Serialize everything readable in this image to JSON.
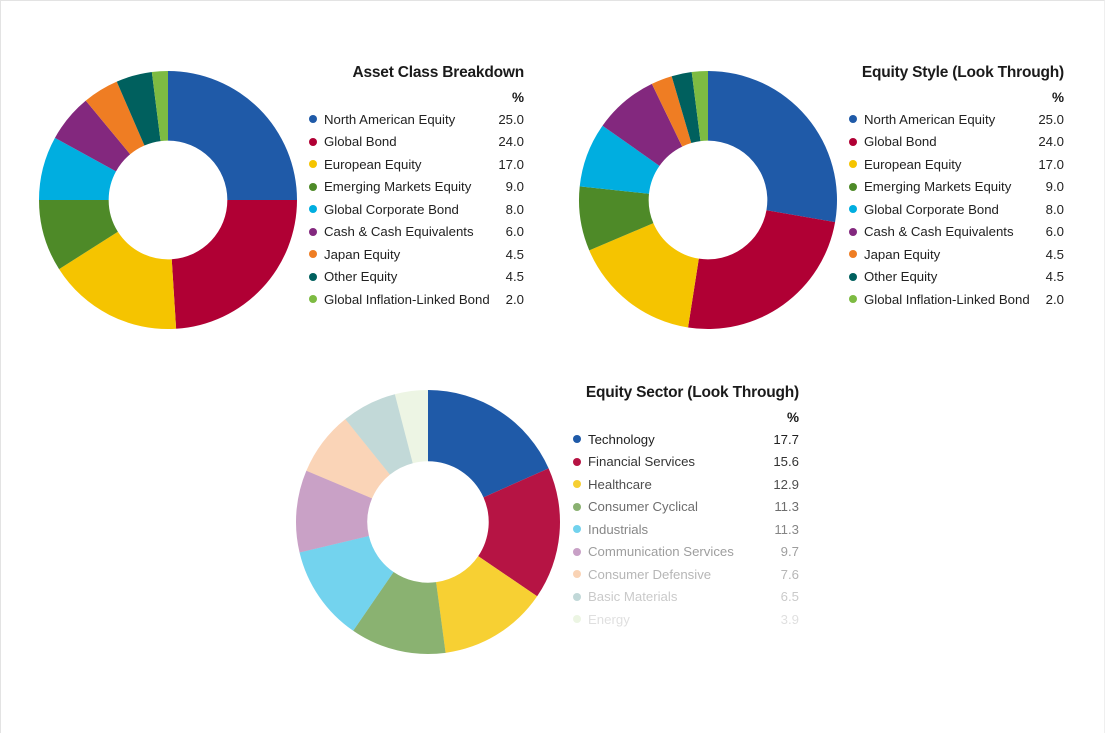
{
  "page": {
    "background": "#ffffff",
    "border_color": "#e3e3e3"
  },
  "palette": {
    "blue": "#1F5AA8",
    "crimson": "#B00034",
    "yellow": "#F5C400",
    "green": "#4E8A28",
    "cyan": "#00AEE0",
    "purple": "#83287E",
    "orange": "#EF7D23",
    "teal": "#00605E",
    "lightgreen": "#7DBB42"
  },
  "charts": [
    {
      "id": "asset-class-breakdown",
      "title": "Asset Class Breakdown",
      "value_header": "%",
      "chart_data": {
        "type": "pie",
        "title": "Asset Class Breakdown",
        "xlabel": "",
        "ylabel": "%",
        "categories": [
          "North American Equity",
          "Global Bond",
          "European Equity",
          "Emerging Markets Equity",
          "Global Corporate Bond",
          "Cash & Cash Equivalents",
          "Japan Equity",
          "Other Equity",
          "Global Inflation-Linked Bond"
        ],
        "values": [
          25.0,
          24.0,
          17.0,
          9.0,
          8.0,
          6.0,
          4.5,
          4.5,
          2.0
        ],
        "value_labels": [
          "25.0",
          "24.0",
          "17.0",
          "9.0",
          "8.0",
          "6.0",
          "4.5",
          "4.5",
          "2.0"
        ],
        "colors": [
          "#1F5AA8",
          "#B00034",
          "#F5C400",
          "#4E8A28",
          "#00AEE0",
          "#83287E",
          "#EF7D23",
          "#00605E",
          "#7DBB42"
        ],
        "legend_position": "right",
        "donut_hole_ratio": 0.46,
        "start_angle_deg": -90,
        "draw_order": [
          0,
          1,
          2,
          3,
          4,
          5,
          6,
          7,
          8
        ]
      }
    },
    {
      "id": "equity-style-look-through",
      "title": "Equity Style (Look Through)",
      "value_header": "%",
      "chart_data": {
        "type": "pie",
        "title": "Equity Style (Look Through)",
        "xlabel": "",
        "ylabel": "%",
        "categories": [
          "North American Equity",
          "Global Bond",
          "European Equity",
          "Emerging Markets Equity",
          "Global Corporate Bond",
          "Cash & Cash Equivalents",
          "Japan Equity",
          "Other Equity",
          "Global Inflation-Linked Bond"
        ],
        "values": [
          25.0,
          24.0,
          17.0,
          9.0,
          8.0,
          6.0,
          4.5,
          4.5,
          2.0
        ],
        "value_labels": [
          "25.0",
          "24.0",
          "17.0",
          "9.0",
          "8.0",
          "6.0",
          "4.5",
          "4.5",
          "2.0"
        ],
        "colors": [
          "#1F5AA8",
          "#B00034",
          "#F5C400",
          "#4E8A28",
          "#00AEE0",
          "#83287E",
          "#EF7D23",
          "#00605E",
          "#7DBB42"
        ],
        "legend_position": "right",
        "donut_hole_ratio": 0.46,
        "start_angle_deg": -90,
        "render_sweeps": [
          27.5,
          24.5,
          16.0,
          8.0,
          8.0,
          8.0,
          2.6,
          2.5,
          2.0
        ]
      }
    },
    {
      "id": "equity-sector-look-through",
      "title": "Equity Sector (Look Through)",
      "value_header": "%",
      "chart_data": {
        "type": "pie",
        "title": "Equity Sector (Look Through)",
        "xlabel": "",
        "ylabel": "%",
        "categories": [
          "Technology",
          "Financial Services",
          "Healthcare",
          "Consumer Cyclical",
          "Industrials",
          "Communication Services",
          "Consumer Defensive",
          "Basic Materials",
          "Energy"
        ],
        "values": [
          17.7,
          15.6,
          12.9,
          11.3,
          11.3,
          9.7,
          7.6,
          6.5,
          3.9
        ],
        "value_labels": [
          "17.7",
          "15.6",
          "12.9",
          "11.3",
          "11.3",
          "9.7",
          "7.6",
          "6.5",
          "3.9"
        ],
        "colors": [
          "#1F5AA8",
          "#B00034",
          "#F5C400",
          "#4E8A28",
          "#00AEE0",
          "#83287E",
          "#EF7D23",
          "#00605E",
          "#7DBB42"
        ],
        "row_opacity": [
          1.0,
          0.92,
          0.8,
          0.66,
          0.55,
          0.44,
          0.33,
          0.24,
          0.14
        ],
        "legend_position": "right",
        "donut_hole_ratio": 0.46,
        "start_angle_deg": -90
      }
    }
  ]
}
